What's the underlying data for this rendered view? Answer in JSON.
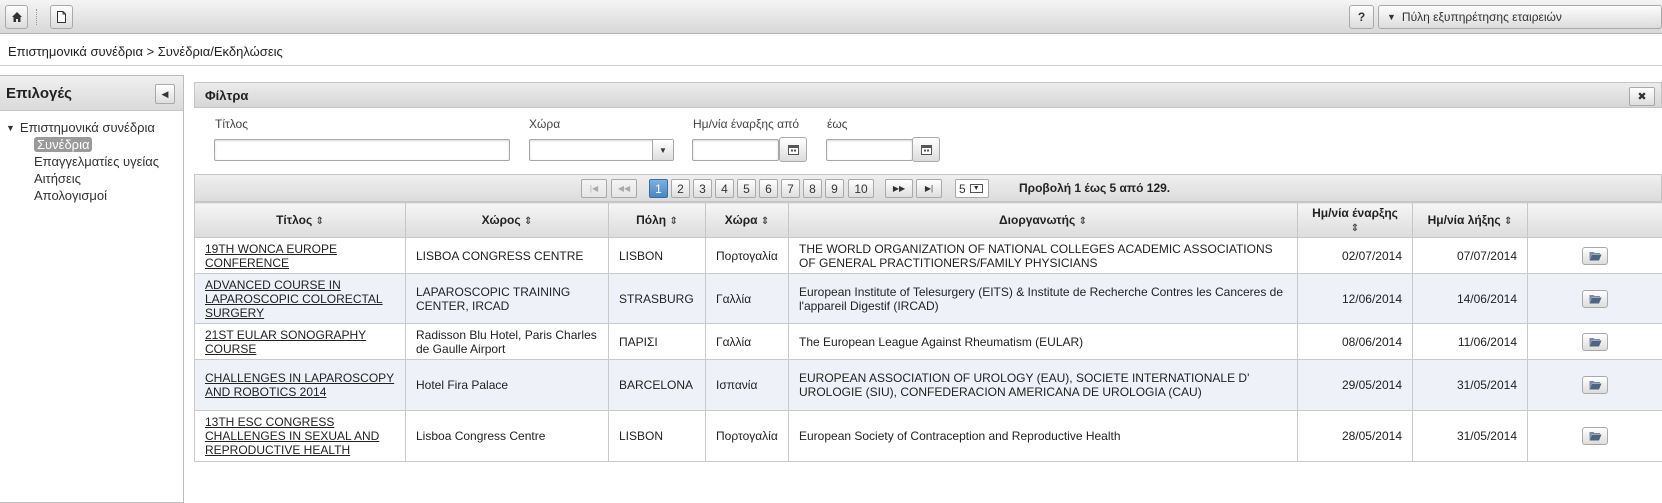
{
  "toolbar": {
    "help_label": "?",
    "portal_label": "Πύλη εξυπηρέτησης εταιρειών"
  },
  "breadcrumb": "Επιστημονικά συνέδρια > Συνέδρια/Εκδηλώσεις",
  "sidebar": {
    "title": "Επιλογές",
    "root": "Επιστημονικά συνέδρια",
    "items": [
      {
        "label": "Συνέδρια",
        "selected": true
      },
      {
        "label": "Επαγγελματίες υγείας"
      },
      {
        "label": "Αιτήσεις"
      },
      {
        "label": "Απολογισμοί"
      }
    ]
  },
  "filters": {
    "title": "Φίλτρα",
    "close_label": "✖",
    "title_label": "Τίτλος",
    "country_label": "Χώρα",
    "date_from_label": "Ημ/νία έναρξης από",
    "date_to_label": "έως",
    "title_value": "",
    "country_value": "",
    "date_from_value": "",
    "date_to_value": ""
  },
  "pager": {
    "pages": [
      "1",
      "2",
      "3",
      "4",
      "5",
      "6",
      "7",
      "8",
      "9",
      "10"
    ],
    "current_page": "1",
    "page_size": "5",
    "summary": "Προβολή 1 έως 5 από 129."
  },
  "table": {
    "columns": [
      "Τίτλος",
      "Χώρος",
      "Πόλη",
      "Χώρα",
      "Διοργανωτής",
      "Ημ/νία έναρξης",
      "Ημ/νία λήξης"
    ],
    "rows": [
      {
        "title": "19TH WONCA EUROPE CONFERENCE",
        "venue": "LISBOA CONGRESS CENTRE",
        "city": "LISBON",
        "country": "Πορτογαλία",
        "organizer": "THE WORLD ORGANIZATION OF NATIONAL COLLEGES ACADEMIC ASSOCIATIONS OF GENERAL PRACTITIONERS/FAMILY PHYSICIANS",
        "start": "02/07/2014",
        "end": "07/07/2014"
      },
      {
        "title": "ADVANCED COURSE IN LAPAROSCOPIC COLORECTAL SURGERY",
        "venue": "LAPAROSCOPIC TRAINING CENTER, IRCAD",
        "city": "STRASBURG",
        "country": "Γαλλία",
        "organizer": "European Institute of Telesurgery (EITS) & Institute de Recherche Contres les Canceres de l'appareil Digestif (IRCAD)",
        "start": "12/06/2014",
        "end": "14/06/2014"
      },
      {
        "title": "21ST EULAR SONOGRAPHY COURSE",
        "venue": "Radisson Blu Hotel, Paris Charles de Gaulle Airport",
        "city": "ΠΑΡΙΣΙ",
        "country": "Γαλλία",
        "organizer": "The European League Against Rheumatism (EULAR)",
        "start": "08/06/2014",
        "end": "11/06/2014"
      },
      {
        "title": "CHALLENGES IN LAPAROSCOPY AND ROBOTICS 2014",
        "venue": "Hotel Fira Palace",
        "city": "BARCELONA",
        "country": "Ισπανία",
        "organizer": "EUROPEAN ASSOCIATION OF UROLOGY (EAU), SOCIETE INTERNATIONALE D' UROLOGIE (SIU), CONFEDERACION AMERICANA DE UROLOGIA (CAU)",
        "start": "29/05/2014",
        "end": "31/05/2014"
      },
      {
        "title": "13TH ESC CONGRESS CHALLENGES IN SEXUAL AND REPRODUCTIVE HEALTH",
        "venue": "Lisboa Congress Centre",
        "city": "LISBON",
        "country": "Πορτογαλία",
        "organizer": "European Society of Contraception and Reproductive Health",
        "start": "28/05/2014",
        "end": "31/05/2014"
      }
    ]
  },
  "colors": {
    "active_page": "#4a86c2",
    "row_alt": "#eef2f8"
  }
}
